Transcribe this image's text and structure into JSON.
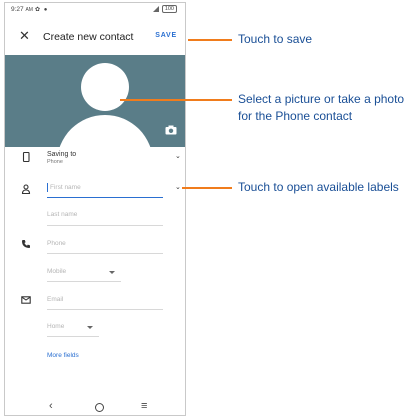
{
  "status_bar": {
    "time": "9:27",
    "time_suffix": "AM",
    "battery": "100"
  },
  "toolbar": {
    "title": "Create new contact",
    "save_label": "SAVE"
  },
  "saving_to": {
    "title": "Saving to",
    "account": "Phone"
  },
  "fields": {
    "first_name_placeholder": "First name",
    "last_name_placeholder": "Last name",
    "phone_placeholder": "Phone",
    "phone_label": "Mobile",
    "email_placeholder": "Email",
    "email_label": "Home"
  },
  "more_fields_label": "More fields",
  "callouts": {
    "save": "Touch to save",
    "picture_line1": "Select a picture or take a photo",
    "picture_line2": "for the Phone contact",
    "labels": "Touch to open available labels"
  },
  "colors": {
    "accent": "#2a6fd1",
    "photo_bg": "#5a7d88",
    "callout_line": "#f07c1c",
    "callout_text": "#1a4f96"
  },
  "icons": [
    "close-icon",
    "camera-icon",
    "phone-device-icon",
    "person-icon",
    "call-icon",
    "email-icon",
    "chevron-down-icon",
    "back-icon",
    "home-icon",
    "recents-icon"
  ]
}
